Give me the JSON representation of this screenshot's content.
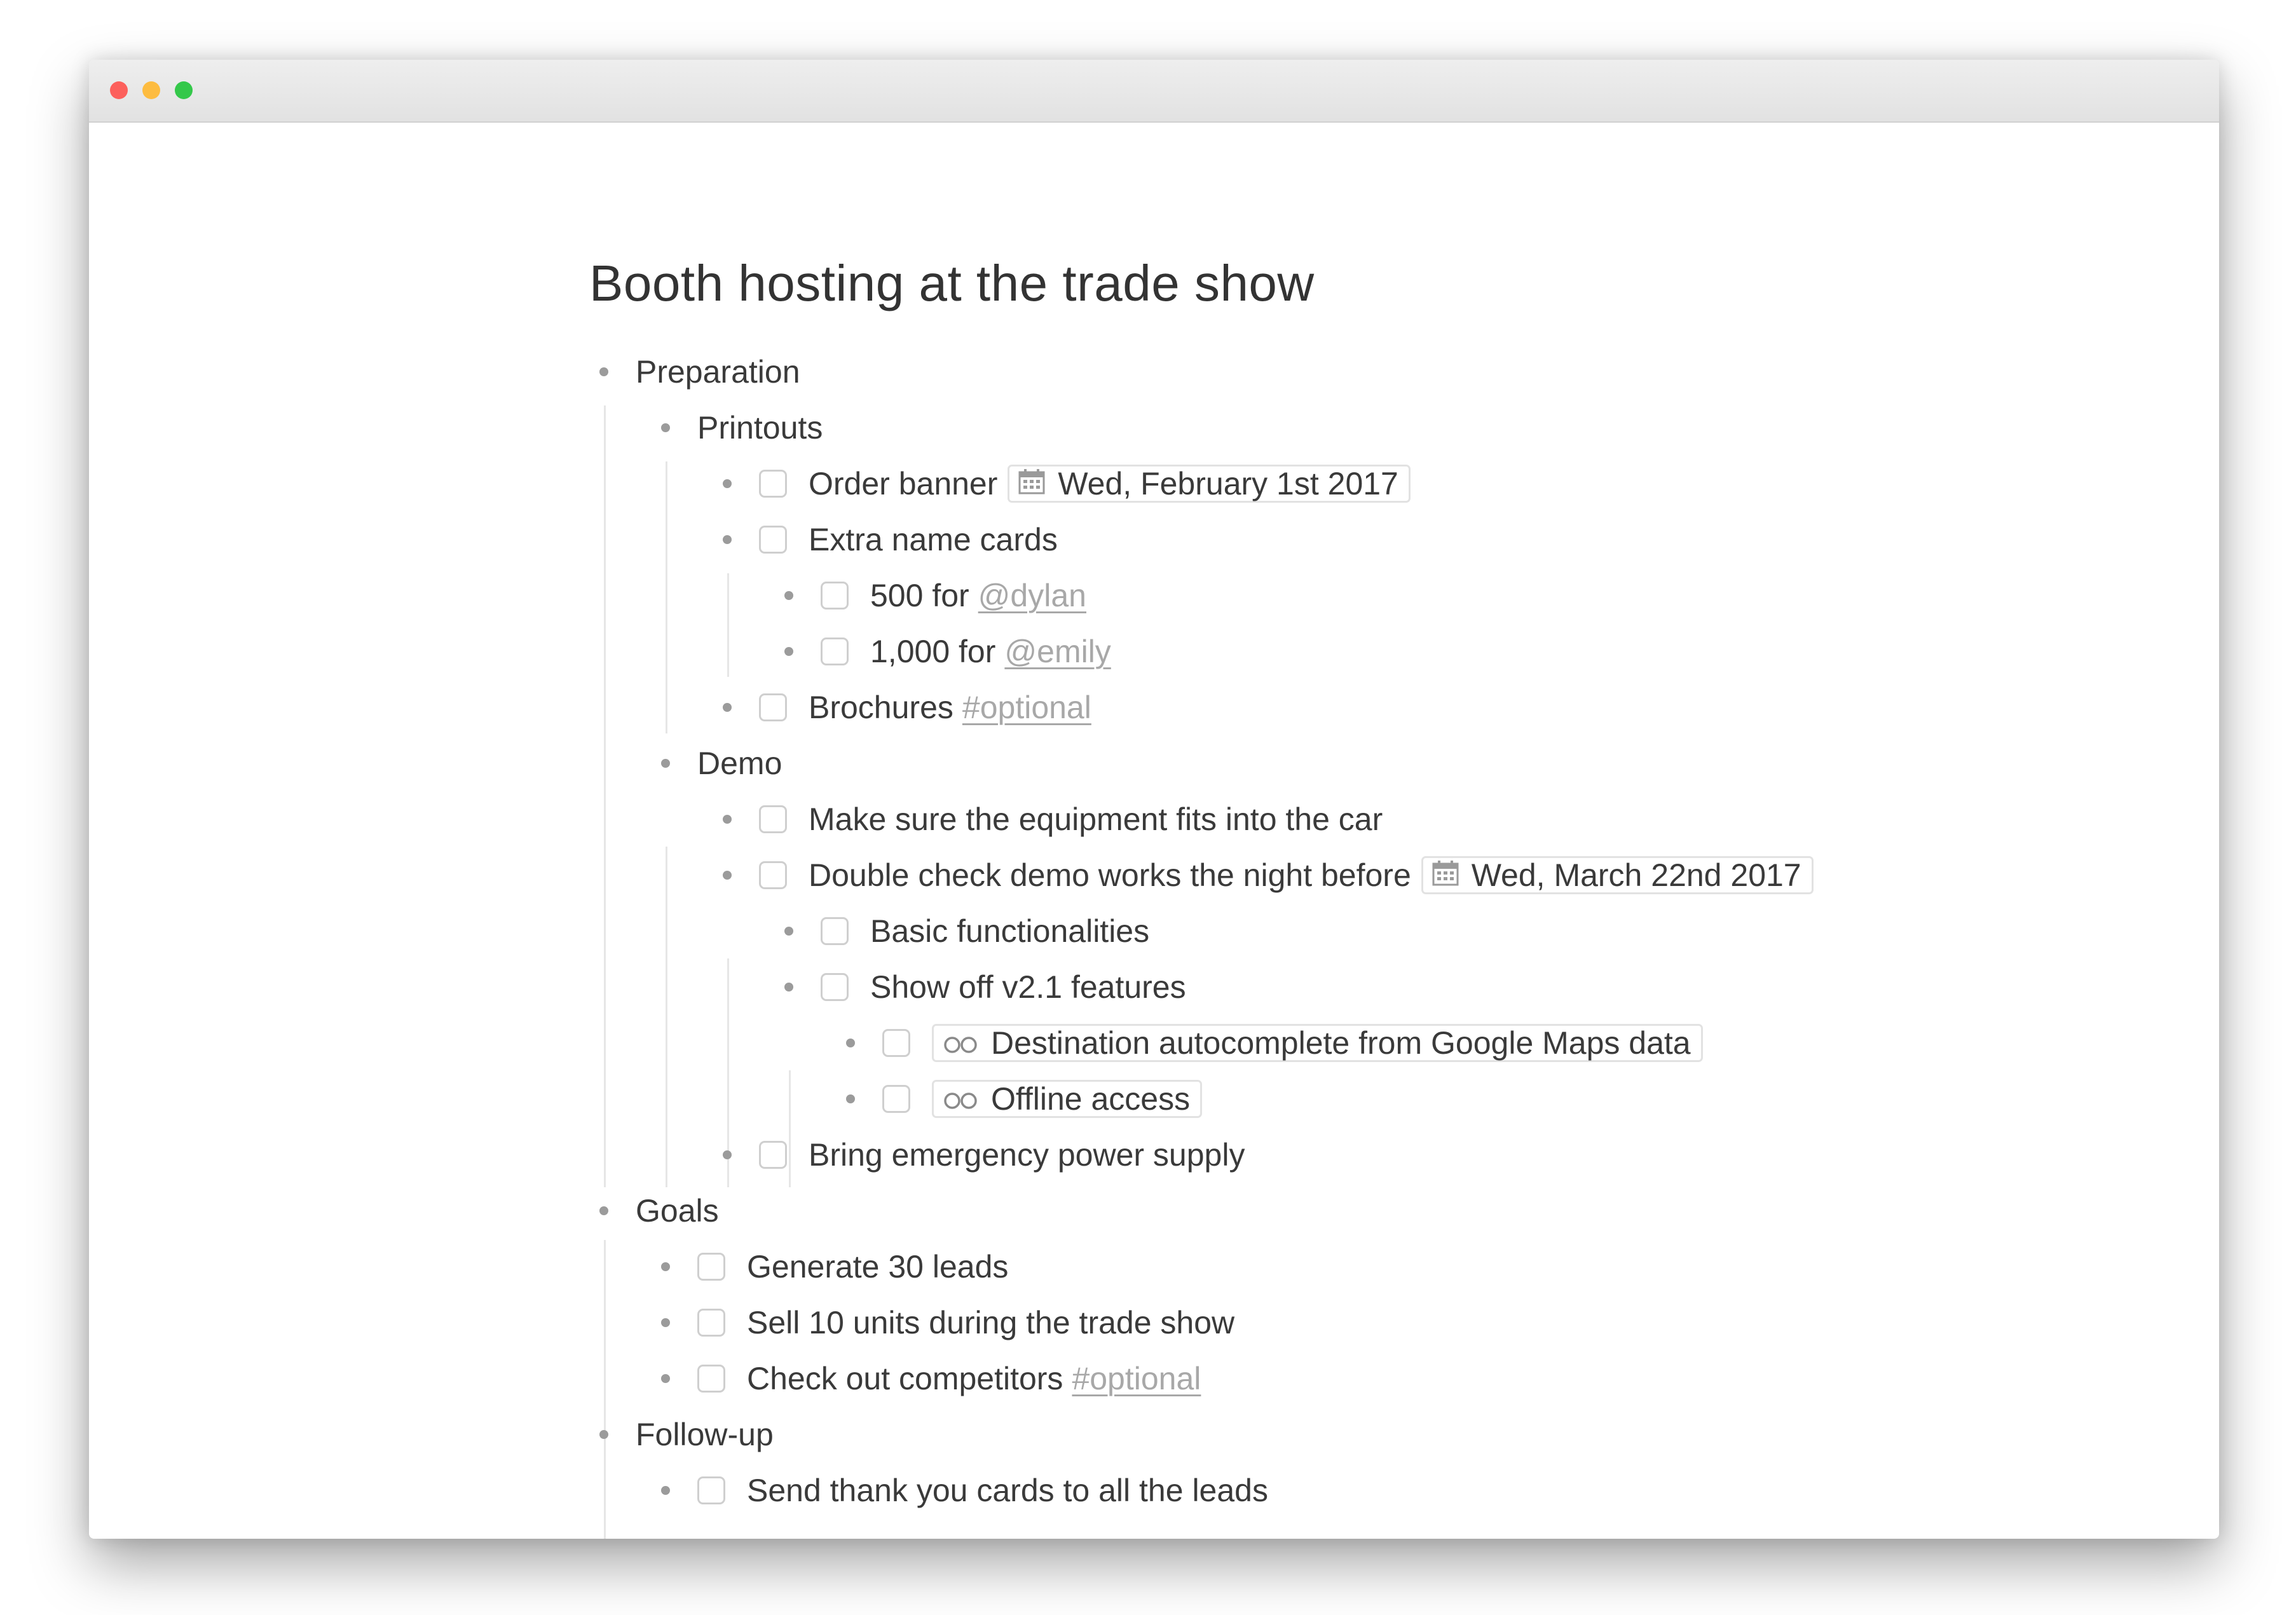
{
  "window": {
    "controls": [
      "close",
      "minimize",
      "maximize"
    ]
  },
  "document": {
    "title": "Booth hosting at the trade show",
    "sections": {
      "preparation": {
        "label": "Preparation",
        "printouts": {
          "label": "Printouts",
          "order_banner": {
            "text": "Order banner",
            "date": "Wed, February 1st 2017",
            "checked": false
          },
          "extra_name_cards": {
            "text": "Extra name cards",
            "checked": false,
            "item_500": {
              "text": "500 for",
              "mention": "@dylan",
              "checked": false
            },
            "item_1000": {
              "text": "1,000 for",
              "mention": "@emily",
              "checked": false
            }
          },
          "brochures": {
            "text": "Brochures",
            "tag": "#optional",
            "checked": false
          }
        },
        "demo": {
          "label": "Demo",
          "equipment": {
            "text": "Make sure the equipment fits into the car",
            "checked": false
          },
          "double_check": {
            "text": "Double check demo works the night before",
            "date": "Wed, March 22nd 2017",
            "checked": false,
            "basic": {
              "text": "Basic functionalities",
              "checked": false
            },
            "show_off": {
              "text": "Show off v2.1 features",
              "checked": false,
              "destination": {
                "text": "Destination autocomplete from Google Maps data",
                "checked": false,
                "icon": "infinity-link-icon"
              },
              "offline": {
                "text": "Offline access",
                "checked": false,
                "icon": "infinity-link-icon"
              }
            }
          },
          "power": {
            "text": "Bring emergency power supply",
            "checked": false
          }
        }
      },
      "goals": {
        "label": "Goals",
        "leads": {
          "text": "Generate 30 leads",
          "checked": false
        },
        "units": {
          "text": "Sell 10 units during the trade show",
          "checked": false
        },
        "competitors": {
          "text": "Check out competitors",
          "tag": "#optional",
          "checked": false
        }
      },
      "followup": {
        "label": "Follow-up",
        "thank_you": {
          "text": "Send thank you cards to all the leads",
          "checked": false
        }
      }
    }
  },
  "colors": {
    "text": "#3a3a3a",
    "tag": "#a8a8a8",
    "bullet": "#9b9b9b",
    "checkbox_border": "#cfcfcf",
    "close": "#fc605c",
    "minimize": "#fdbc40",
    "maximize": "#34c84a"
  }
}
